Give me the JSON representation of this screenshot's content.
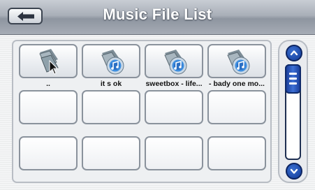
{
  "header": {
    "title": "Music File List",
    "back_icon": "left-arrow-icon"
  },
  "files": [
    {
      "label": "..",
      "icon": "folder-up-icon"
    },
    {
      "label": "it s ok",
      "icon": "music-file-icon"
    },
    {
      "label": "sweetbox - life...",
      "icon": "music-file-icon"
    },
    {
      "label": "- bady one mo...",
      "icon": "music-file-icon"
    }
  ],
  "empty_slots": 8,
  "scrollbar": {
    "up_icon": "chevron-up-icon",
    "down_icon": "chevron-down-icon",
    "position": 0
  },
  "colors": {
    "accent": "#1b3f9c",
    "header_text": "#ffffff"
  }
}
